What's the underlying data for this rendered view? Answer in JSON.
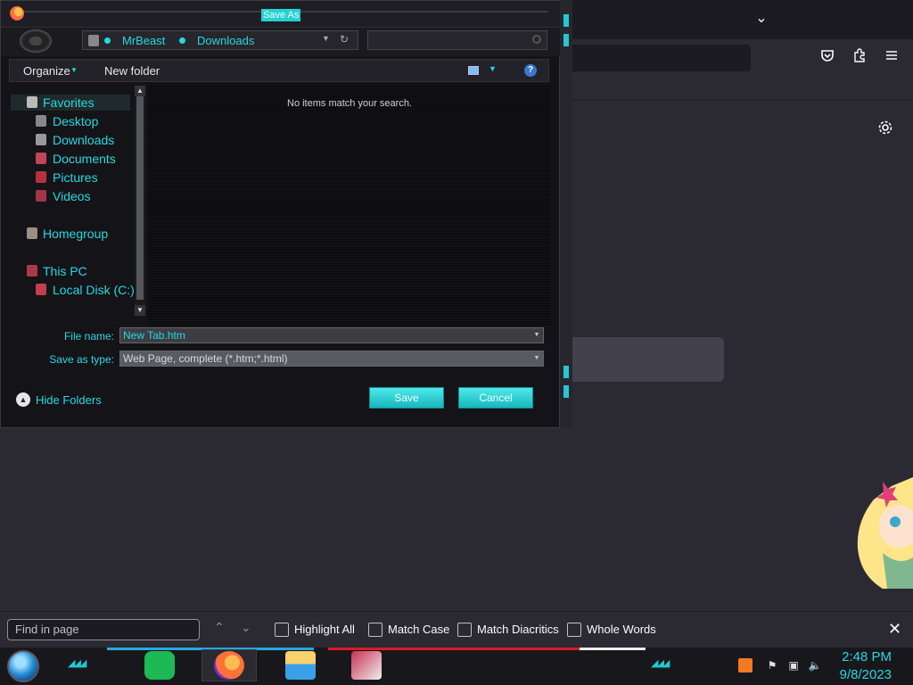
{
  "dialog": {
    "title": "Save As",
    "breadcrumb": [
      "MrBeast",
      "Downloads"
    ],
    "toolbar": {
      "organize": "Organize",
      "new_folder": "New folder"
    },
    "empty_message": "No items match your search.",
    "nav": {
      "favorites": "Favorites",
      "favorite_items": [
        "Desktop",
        "Downloads",
        "Documents",
        "Pictures",
        "Videos"
      ],
      "homegroup": "Homegroup",
      "this_pc": "This PC",
      "local_disk": "Local Disk (C:)"
    },
    "file_name_label": "File name:",
    "file_name_value": "New Tab.htm",
    "save_type_label": "Save as type:",
    "save_type_value": "Web Page, complete (*.htm;*.html)",
    "hide_folders": "Hide Folders",
    "save_button": "Save",
    "cancel_button": "Cancel"
  },
  "findbar": {
    "placeholder": "Find in page",
    "highlight_all": "Highlight All",
    "match_case": "Match Case",
    "match_diacritics": "Match Diacritics",
    "whole_words": "Whole Words"
  },
  "taskbar": {
    "time": "2:48 PM",
    "date": "9/8/2023"
  },
  "colors": {
    "accent": "#27d8e0",
    "dialog_bg": "#141418",
    "browser_bg": "#2b2a33"
  },
  "icons": [
    "firefox-icon",
    "chevron-down-icon",
    "pocket-icon",
    "extensions-icon",
    "menu-icon",
    "settings-gear-icon",
    "close-icon",
    "spotify-icon",
    "file-explorer-icon"
  ]
}
